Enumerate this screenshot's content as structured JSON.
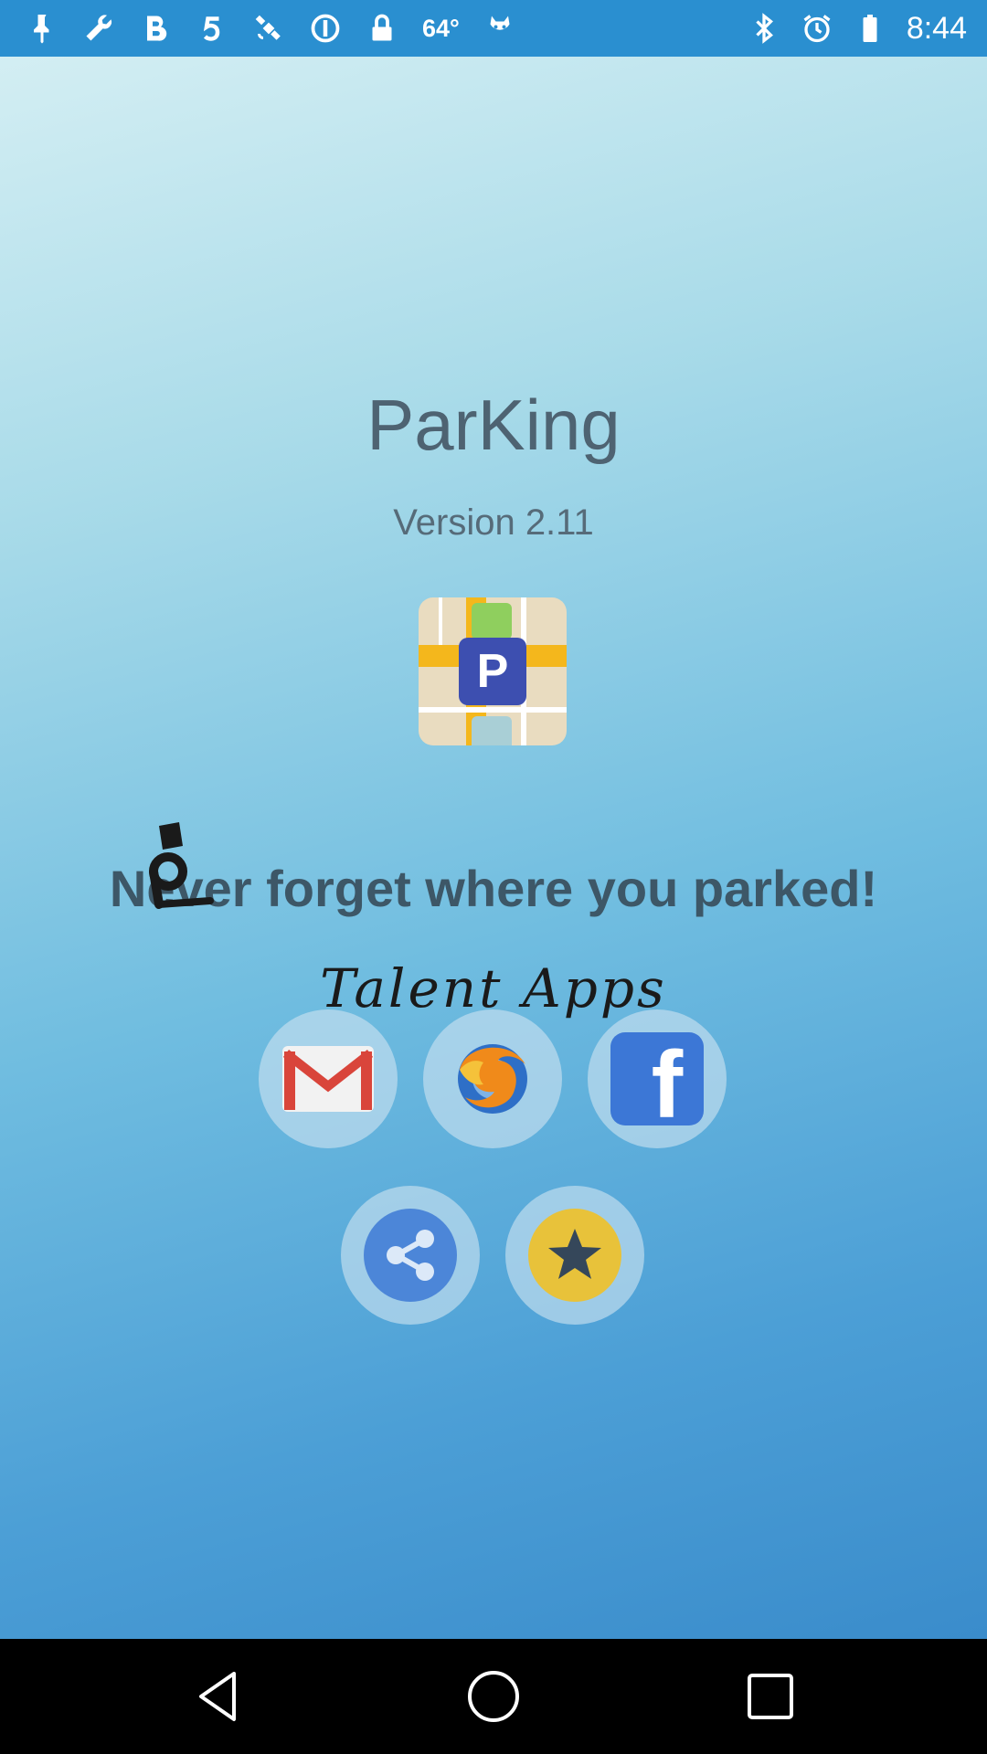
{
  "status_bar": {
    "temperature": "64°",
    "time": "8:44"
  },
  "app": {
    "title": "ParKing",
    "version": "Version 2.11",
    "logo_letter": "P",
    "tagline": "Never forget where you parked!",
    "brand": "Talent Apps"
  },
  "share_buttons": [
    {
      "name": "gmail",
      "icon": "gmail-icon"
    },
    {
      "name": "browser",
      "icon": "firefox-icon"
    },
    {
      "name": "facebook",
      "icon": "facebook-icon",
      "letter": "f"
    }
  ],
  "action_buttons": [
    {
      "name": "share",
      "icon": "share-icon"
    },
    {
      "name": "rate",
      "icon": "star-icon"
    }
  ],
  "nav": [
    "back",
    "home",
    "recents"
  ],
  "colors": {
    "status_bar": "#2a8fd0",
    "title_text": "#4e6372",
    "tagline_text": "#3d5767",
    "logo_blue": "#3d4fb0",
    "star_yellow": "#e8c23a",
    "share_blue": "#4c86d8",
    "facebook_blue": "#3c77d6"
  }
}
